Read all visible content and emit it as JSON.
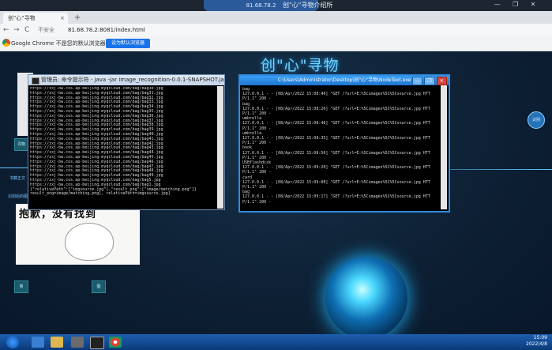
{
  "remote_bar": {
    "ip": "81.68.78.2",
    "window_title": "创\"心\"寻物介绍所",
    "controls": [
      "—",
      "❐",
      "✕"
    ]
  },
  "browser": {
    "tab_title": "创\"心\"寻物",
    "tab_close": "×",
    "new_tab": "+",
    "nav_back": "←",
    "nav_forward": "→",
    "nav_reload": "C",
    "security": "不安全",
    "url": "81.68.78.2:8081/index.html",
    "info_bar_text": "Google Chrome 不是您的默认浏览器",
    "default_button": "设为默认浏览器"
  },
  "page": {
    "title": "创\"心\"寻物",
    "right_circle": "识别",
    "left_square_top": "寻物",
    "left_square_a": "简",
    "left_square_b": "图",
    "left_text_1": "书籍正文",
    "left_text_2": "识别后的图",
    "sorry_text": "抱歉，没有找到"
  },
  "java_window": {
    "title": "管理员: 命令提示符 - java -jar image_recognition-0.0.1-SNAPSHOT.jar",
    "lines": [
      "https://zxj-bw.cos.ap-beijing.myqcloud.com/bag/bag30.jpg",
      "https://zxj-bw.cos.ap-beijing.myqcloud.com/bag/bag31.jpg",
      "https://zxj-bw.cos.ap-beijing.myqcloud.com/bag/bag32.jpg",
      "https://zxj-bw.cos.ap-beijing.myqcloud.com/bag/bag33.jpg",
      "https://zxj-bw.cos.ap-beijing.myqcloud.com/bag/bag34.jpg",
      "https://zxj-bw.cos.ap-beijing.myqcloud.com/bag/bag35.jpg",
      "https://zxj-bw.cos.ap-beijing.myqcloud.com/bag/bag36.jpg",
      "https://zxj-bw.cos.ap-beijing.myqcloud.com/bag/bag37.jpg",
      "https://zxj-bw.cos.ap-beijing.myqcloud.com/bag/bag38.jpg",
      "https://zxj-bw.cos.ap-beijing.myqcloud.com/bag/bag39.jpg",
      "https://zxj-bw.cos.ap-beijing.myqcloud.com/bag/bag40.jpg",
      "https://zxj-bw.cos.ap-beijing.myqcloud.com/bag/bag41.jpg",
      "https://zxj-bw.cos.ap-beijing.myqcloud.com/bag/bag42.jpg",
      "https://zxj-bw.cos.ap-beijing.myqcloud.com/bag/bag43.jpg",
      "https://zxj-bw.cos.ap-beijing.myqcloud.com/bag/bag44.jpg",
      "https://zxj-bw.cos.ap-beijing.myqcloud.com/bag/bag45.jpg",
      "https://zxj-bw.cos.ap-beijing.myqcloud.com/bag/bag46.jpg",
      "https://zxj-bw.cos.ap-beijing.myqcloud.com/bag/bag47.jpg",
      "https://zxj-bw.cos.ap-beijing.myqcloud.com/bag/bag48.jpg",
      "https://zxj-bw.cos.ap-beijing.myqcloud.com/bag/bag49.jpg",
      "https://zxj-bw.cos.ap-beijing.myqcloud.com/bag/bag5.jpg",
      "https://zxj-bw.cos.ap-beijing.myqcloud.com/bag/bag1.jpg",
      "{\"relativePath\":[\"imgsource.jpg\"],\"result_png\":[\"image/matching.png\"]}",
      "result_png=image/matching.png], relativePath=imgsource.jpg]"
    ]
  },
  "node_window": {
    "title": "C:\\Users\\Administrator\\Desktop\\创\"心\"寻物\\NodeText.exe",
    "controls": [
      "—",
      "❐",
      "✕"
    ],
    "lines": [
      "bag",
      "127.0.0.1 - - [08/Apr/2022 15:08:40] \"GET /?url=E:%5Cimages%5C%5Csource.jpg HTT",
      "P/1.1\" 200 -",
      "bag",
      "127.0.0.1 - - [08/Apr/2022 15:08:26] \"GET /?url=E:%5Cimages%5C%5Csource.jpg HTT",
      "P/1.1\" 200 -",
      "umbrella",
      "127.0.0.1 - - [08/Apr/2022 15:08:48] \"GET /?url=E:%5Cimages%5C%5Csource.jpg HTT",
      "P/1.1\" 200 -",
      "umbrella",
      "127.0.0.1 - - [08/Apr/2022 15:08:35] \"GET /?url=E:%5Cimages%5C%5Csource.jpg HTT",
      "P/1.1\" 200 -",
      "book",
      "127.0.0.1 - - [08/Apr/2022 15:08:56] \"GET /?url=E:%5Cimages%5C%5Csource.jpg HTT",
      "P/1.1\" 200 -",
      "USBflashdisk",
      "127.0.0.1 - - [08/Apr/2022 15:09:20] \"GET /?url=E:%5Cimages%5C%5Csource.jpg HTT",
      "P/1.1\" 200 -",
      "card",
      "127.0.0.1 - - [08/Apr/2022 15:09:08] \"GET /?url=E:%5Cimages%5C%5Csource.jpg HTT",
      "P/1.1\" 200 -",
      "bag",
      "127.0.0.1 - - [08/Apr/2022 15:09:17] \"GET /?url=E:%5Cimages%5C%5Csource.jpg HTT",
      "P/1.1\" 200 -"
    ]
  },
  "taskbar": {
    "time": "15:09",
    "date": "2022/4/8"
  }
}
